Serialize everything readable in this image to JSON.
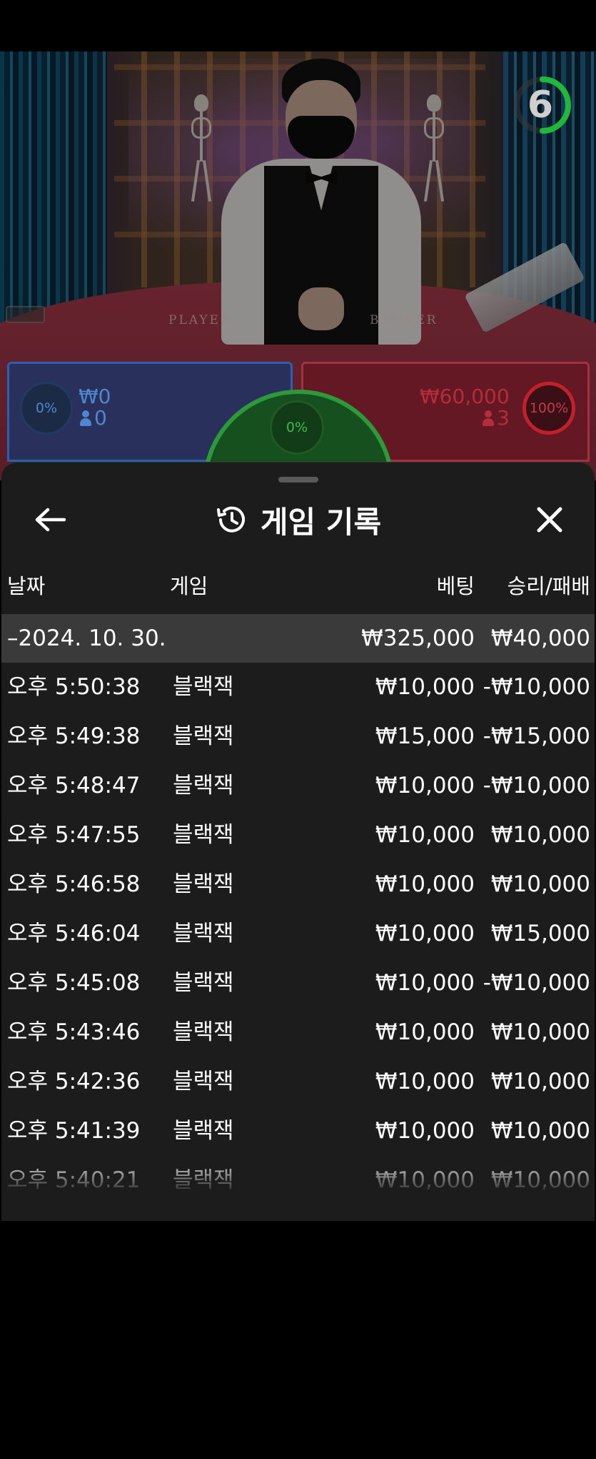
{
  "stream": {
    "countdown": "6",
    "table_labels": {
      "player": "PLAYER",
      "banker": "BANKER"
    }
  },
  "betting": {
    "player": {
      "percent": "0%",
      "amount": "₩0",
      "players": "0"
    },
    "tie": {
      "percent": "0%"
    },
    "banker": {
      "percent": "100%",
      "amount": "₩60,000",
      "players": "3"
    }
  },
  "history": {
    "title": "게임 기록",
    "columns": {
      "date": "날짜",
      "game": "게임",
      "bet": "베팅",
      "win_loss": "승리/패배"
    },
    "group": {
      "date": "–2024. 10. 30.",
      "bet": "₩325,000",
      "win_loss": "₩40,000"
    },
    "rows": [
      {
        "time": "오후 5:50:38",
        "game": "블랙잭",
        "bet": "₩10,000",
        "win_loss": "-₩10,000"
      },
      {
        "time": "오후 5:49:38",
        "game": "블랙잭",
        "bet": "₩15,000",
        "win_loss": "-₩15,000"
      },
      {
        "time": "오후 5:48:47",
        "game": "블랙잭",
        "bet": "₩10,000",
        "win_loss": "-₩10,000"
      },
      {
        "time": "오후 5:47:55",
        "game": "블랙잭",
        "bet": "₩10,000",
        "win_loss": "₩10,000"
      },
      {
        "time": "오후 5:46:58",
        "game": "블랙잭",
        "bet": "₩10,000",
        "win_loss": "₩10,000"
      },
      {
        "time": "오후 5:46:04",
        "game": "블랙잭",
        "bet": "₩10,000",
        "win_loss": "₩15,000"
      },
      {
        "time": "오후 5:45:08",
        "game": "블랙잭",
        "bet": "₩10,000",
        "win_loss": "-₩10,000"
      },
      {
        "time": "오후 5:43:46",
        "game": "블랙잭",
        "bet": "₩10,000",
        "win_loss": "₩10,000"
      },
      {
        "time": "오후 5:42:36",
        "game": "블랙잭",
        "bet": "₩10,000",
        "win_loss": "₩10,000"
      },
      {
        "time": "오후 5:41:39",
        "game": "블랙잭",
        "bet": "₩10,000",
        "win_loss": "₩10,000"
      },
      {
        "time": "오후 5:40:21",
        "game": "블랙잭",
        "bet": "₩10,000",
        "win_loss": "₩10,000"
      }
    ]
  },
  "icons": {
    "back": "arrow-left-icon",
    "history": "history-clock-icon",
    "close": "close-icon"
  },
  "colors": {
    "player_blue": "#4f86d0",
    "banker_red": "#c4202c",
    "tie_green": "#2c9a3a",
    "timer_green": "#1fb83a"
  }
}
